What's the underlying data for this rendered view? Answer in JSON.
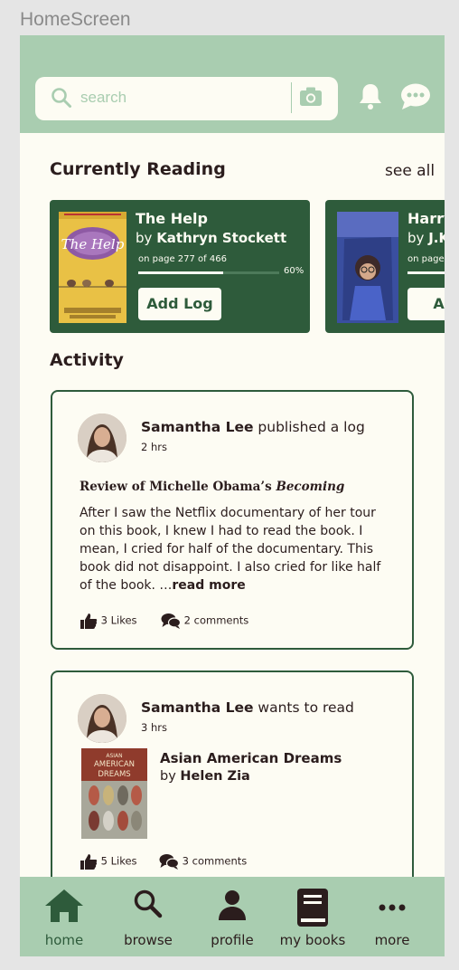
{
  "frame_label": "HomeScreen",
  "search": {
    "placeholder": "search"
  },
  "icons": {
    "search": "search-icon",
    "camera": "camera-icon",
    "bell": "bell-icon",
    "chat": "chat-icon"
  },
  "colors": {
    "primary": "#2e5b3b",
    "accent": "#a9cdb0",
    "background": "#fdfcf3",
    "text": "#2b1d1d"
  },
  "currently_reading": {
    "title": "Currently Reading",
    "see_all": "see all",
    "books": [
      {
        "title": "The Help",
        "by": "by",
        "author": "Kathryn Stockett",
        "progress_text": "on page 277 of 466",
        "progress_pct_label": "60%",
        "progress": 0.6,
        "add_log": "Add Log"
      },
      {
        "title": "Harry",
        "by": "by",
        "author": "J.K",
        "progress_text": "on page",
        "progress": 0.6,
        "add_log": "Add"
      }
    ]
  },
  "activity": {
    "title": "Activity",
    "posts": [
      {
        "user": "Samantha Lee",
        "action": "published a log",
        "time": "2 hrs",
        "review_title_prefix": "Review of Michelle Obama’s",
        "review_title_book": "Becoming",
        "body": "After I saw the Netflix documentary of her tour on this book, I knew I had to read the book. I mean, I cried for half of the documentary. This book did not disappoint. I also cried for like half of the book. …",
        "read_more": "read more",
        "likes": "3 Likes",
        "comments": "2 comments"
      },
      {
        "user": "Samantha Lee",
        "action": "wants to read",
        "time": "3 hrs",
        "book_title": "Asian American Dreams",
        "by": "by",
        "book_author": "Helen Zia",
        "likes": "5 Likes",
        "comments": "3 comments"
      }
    ]
  },
  "nav": [
    {
      "label": "home",
      "icon": "home-icon",
      "active": true
    },
    {
      "label": "browse",
      "icon": "search-icon"
    },
    {
      "label": "profile",
      "icon": "person-icon"
    },
    {
      "label": "my books",
      "icon": "book-icon"
    },
    {
      "label": "more",
      "icon": "more-icon"
    }
  ]
}
